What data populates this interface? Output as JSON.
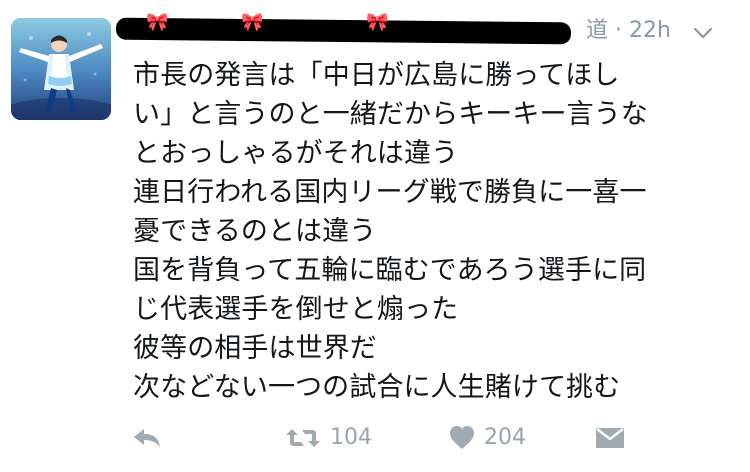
{
  "tweet": {
    "timestamp": "22h",
    "separator": "·",
    "author_name_visible": "道",
    "lines": [
      "市長の発言は「中日が広島に勝ってほし",
      "い」と言うのと一緒だからキーキー言うな",
      "とおっしゃるがそれは違う",
      "連日行われる国内リーグ戦で勝負に一喜一",
      "憂できるのとは違う",
      "国を背負って五輪に臨むであろう選手に同",
      "じ代表選手を倒せと煽った",
      "彼等の相手は世界だ",
      "次などない一つの試合に人生賭けて挑む"
    ],
    "retweet_count": "104",
    "like_count": "204"
  },
  "icons": {
    "reply": "reply-icon",
    "retweet": "retweet-icon",
    "like": "heart-icon",
    "dm": "envelope-icon",
    "menu": "chevron-down-icon"
  },
  "colors": {
    "text": "#14171a",
    "muted": "#8899a6",
    "action": "#a0aab3"
  }
}
